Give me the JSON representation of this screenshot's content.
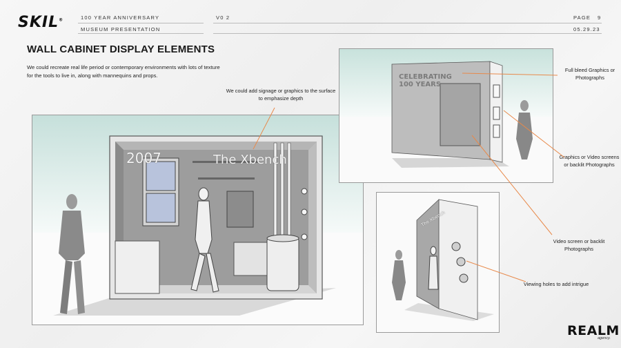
{
  "brand": {
    "logo_text": "SKIL",
    "trademark": "®"
  },
  "header": {
    "line1": "100 YEAR ANNIVERSARY",
    "line2": "MUSEUM PRESENTATION",
    "version": "V0 2",
    "page_label": "PAGE",
    "page_number": "9",
    "date": "05.29.23"
  },
  "title": "WALL CABINET DISPLAY ELEMENTS",
  "intro": "We could recreate real life period or contemporary environments with lots of texture for the tools to live in, along with mannequins and props.",
  "callouts": {
    "signage": "We could add signage or graphics to the surface to emphasize depth",
    "full_bleed": "Full bleed Graphics or Photographs",
    "screens": "Graphics or Video screens or backlit Photographs",
    "video_screen": "Video screen or backlit Photographs",
    "viewing_holes": "Viewing holes to add intrigue"
  },
  "scene_text": {
    "year": "2007",
    "xbench": "The Xbench",
    "celebrating_line1": "CELEBRATING",
    "celebrating_line2": "100 YEARS",
    "small_panel_sign": "The Xbench"
  },
  "colors": {
    "accent_line": "#e8894a",
    "sky": "#cfe6e1"
  },
  "agency": {
    "name": "REALM",
    "sub": "agency."
  }
}
